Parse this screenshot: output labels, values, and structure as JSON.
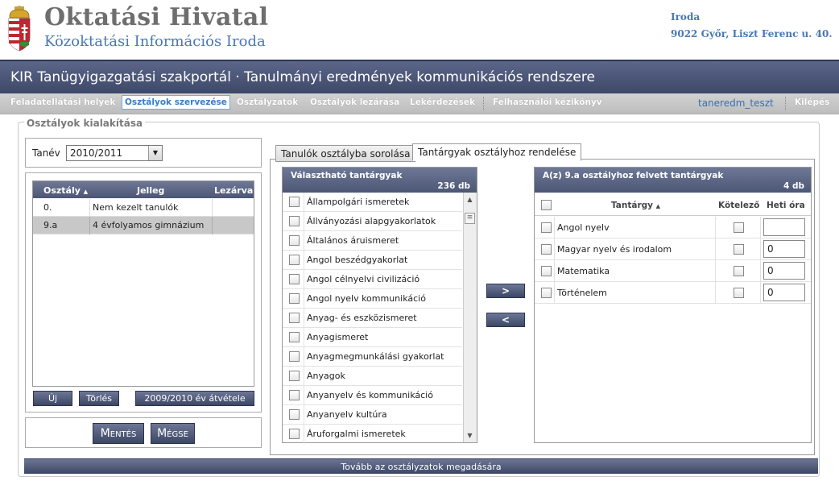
{
  "header": {
    "org_title": "Oktatási Hivatal",
    "org_subtitle": "Közoktatási Információs Iroda",
    "address_line1": "Iroda",
    "address_line2": "9022 Győr, Liszt Ferenc u. 40.",
    "portal_title": "KIR Tanügyigazgatási szakportál · Tanulmányi eredmények kommunikációs rendszere"
  },
  "menu": {
    "items": [
      "Feladatellátási helyek",
      "Osztályok szervezése",
      "Osztályzatok",
      "Osztályok lezárása",
      "Lekérdezések",
      "Felhasználói kézikönyv"
    ],
    "user": "taneredm_teszt",
    "logout": "Kilépés"
  },
  "section": {
    "legend": "Osztályok kialakítása",
    "tanev_label": "Tanév",
    "tanev_value": "2010/2011"
  },
  "class_table": {
    "headers": [
      "Osztály",
      "Jelleg",
      "Lezárva"
    ],
    "rows": [
      {
        "osztaly": "0.",
        "jelleg": "Nem kezelt tanulók",
        "lezarva": ""
      },
      {
        "osztaly": "9.a",
        "jelleg": "4 évfolyamos gimnázium",
        "lezarva": ""
      }
    ],
    "btn_new": "Új",
    "btn_delete": "Törlés",
    "btn_transfer": "2009/2010 év átvétele"
  },
  "actions": {
    "save": "Mentés",
    "cancel": "Mégse",
    "next": "Tovább az osztályzatok megadására"
  },
  "tabs": [
    "Tanulók osztályba sorolása",
    "Tantárgyak osztályhoz rendelése"
  ],
  "available": {
    "title": "Választható tantárgyak",
    "count": "236 db",
    "items": [
      "Állampolgári ismeretek",
      "Állványozási alapgyakorlatok",
      "Általános áruismeret",
      "Angol beszédgyakorlat",
      "Angol célnyelvi civilizáció",
      "Angol nyelv kommunikáció",
      "Anyag- és eszközismeret",
      "Anyagismeret",
      "Anyagmegmunkálási gyakorlat",
      "Anyagok",
      "Anyanyelv és kommunikáció",
      "Anyanyelv kultúra",
      "Áruforgalmi ismeretek"
    ]
  },
  "move": {
    "add": ">",
    "remove": "<"
  },
  "assigned": {
    "title": "A(z) 9.a osztályhoz felvett tantárgyak",
    "count": "4 db",
    "headers": [
      "Tantárgy",
      "Kötelező",
      "Heti óra"
    ],
    "rows": [
      {
        "name": "Angol nyelv",
        "hours": ""
      },
      {
        "name": "Magyar nyelv és irodalom",
        "hours": "0"
      },
      {
        "name": "Matematika",
        "hours": "0"
      },
      {
        "name": "Történelem",
        "hours": "0"
      }
    ]
  },
  "colors": {
    "header_dark": "#4c5675",
    "brand_blue": "#4a78b2",
    "menu_active": "#3a7bc8"
  }
}
